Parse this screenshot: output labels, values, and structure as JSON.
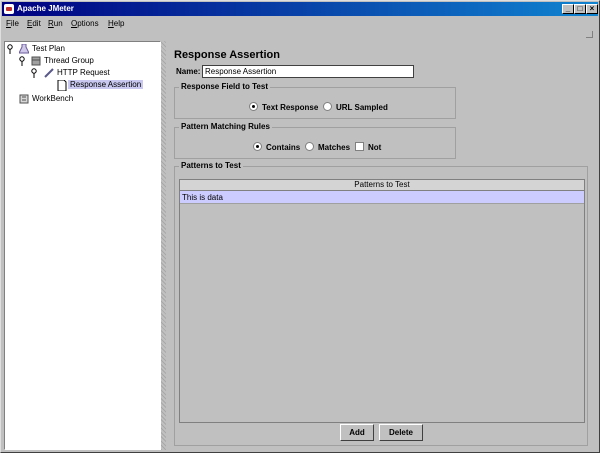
{
  "window": {
    "title": "Apache JMeter"
  },
  "menu": [
    {
      "u": "F",
      "rest": "ile"
    },
    {
      "u": "E",
      "rest": "dit"
    },
    {
      "u": "R",
      "rest": "un"
    },
    {
      "u": "O",
      "rest": "ptions"
    },
    {
      "u": "H",
      "rest": "elp"
    }
  ],
  "tree": {
    "nodes": [
      {
        "label": "Test Plan",
        "icon": "flask-icon"
      },
      {
        "label": "Thread Group",
        "icon": "spool-icon"
      },
      {
        "label": "HTTP Request",
        "icon": "pipette-icon"
      },
      {
        "label": "Response Assertion",
        "icon": "document-icon",
        "selected": true
      },
      {
        "label": "WorkBench",
        "icon": "workbench-icon"
      }
    ]
  },
  "panel": {
    "heading": "Response Assertion",
    "name_label": "Name:",
    "name_value": "Response Assertion",
    "response_field": {
      "title": "Response Field to Test",
      "options": [
        "Text Response",
        "URL Sampled"
      ],
      "selected": "Text Response"
    },
    "pattern_rules": {
      "title": "Pattern Matching Rules",
      "options": [
        "Contains",
        "Matches"
      ],
      "selected": "Contains",
      "not_label": "Not",
      "not_checked": false
    },
    "patterns": {
      "title": "Patterns to Test",
      "column": "Patterns to Test",
      "rows": [
        "This is data"
      ]
    },
    "buttons": {
      "add": "Add",
      "delete": "Delete"
    }
  }
}
